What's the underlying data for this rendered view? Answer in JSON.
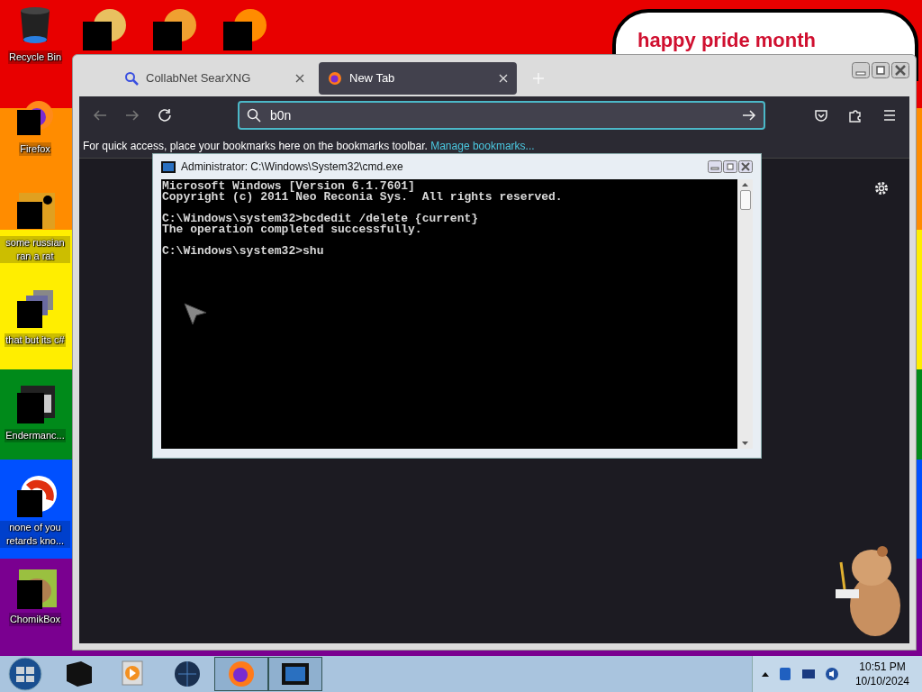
{
  "desktop": {
    "banner": "happy pride month",
    "icons": [
      {
        "label": "Recycle Bin",
        "kind": "bin"
      },
      {
        "label": "Firefox",
        "kind": "firefox"
      },
      {
        "label": "some russian ran a rat",
        "kind": "app"
      },
      {
        "label": "that but its c#",
        "kind": "stack"
      },
      {
        "label": "Endermanc...",
        "kind": "window"
      },
      {
        "label": "none of you retards kno...",
        "kind": "round"
      },
      {
        "label": "ChomikBox",
        "kind": "hamster"
      }
    ]
  },
  "browser": {
    "tabs": [
      {
        "title": "CollabNet SearXNG",
        "kind": "search",
        "selected": false
      },
      {
        "title": "New Tab",
        "kind": "firefox",
        "selected": true
      }
    ],
    "address": "b0n",
    "bookmarks_bar": {
      "text": "For quick access, place your bookmarks here on the bookmarks toolbar.",
      "link": "Manage bookmarks..."
    }
  },
  "cmd": {
    "title": "Administrator: C:\\Windows\\System32\\cmd.exe",
    "lines": [
      {
        "text": "Microsoft Windows [Version 6.1.7601]",
        "blank_before": false
      },
      {
        "text": "Copyright (c) 2011 Neo Reconia Sys.  All rights reserved.",
        "blank_before": false
      },
      {
        "text": "C:\\Windows\\system32>bcdedit /delete {current}",
        "blank_before": true
      },
      {
        "text": "The operation completed successfully.",
        "blank_before": false
      },
      {
        "text": "C:\\Windows\\system32>shu",
        "blank_before": true
      }
    ]
  },
  "taskbar": {
    "buttons": [
      {
        "kind": "box",
        "selected": false
      },
      {
        "kind": "media",
        "selected": false
      },
      {
        "kind": "globe",
        "selected": false
      },
      {
        "kind": "firefox",
        "selected": true
      },
      {
        "kind": "console",
        "selected": true
      }
    ],
    "time": "10:51 PM",
    "date": "10/10/2024"
  }
}
